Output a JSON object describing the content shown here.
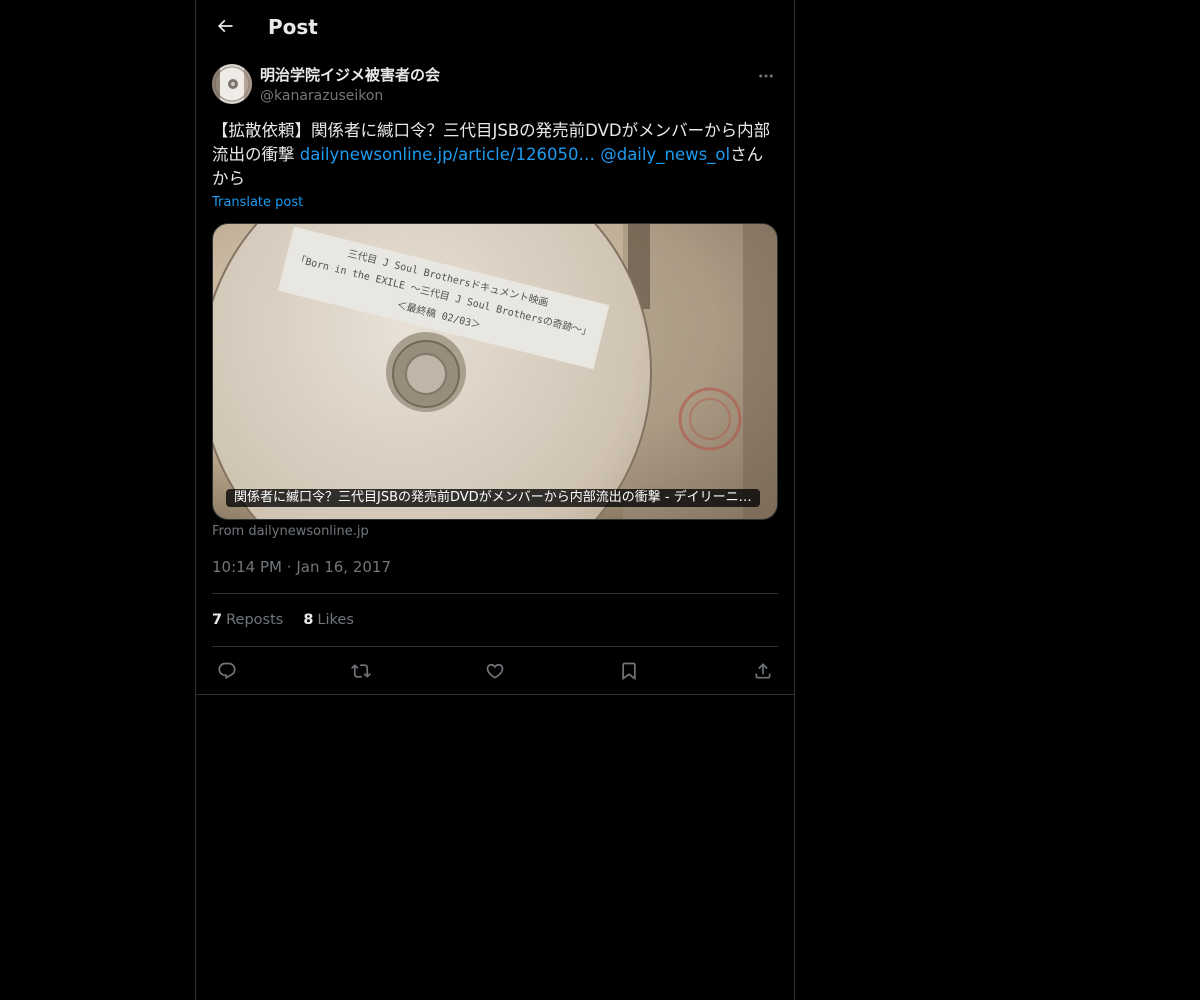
{
  "header": {
    "title": "Post",
    "back_icon": "arrow-left-icon"
  },
  "author": {
    "display_name": "明治学院イジメ被害者の会",
    "handle": "@kanarazuseikon",
    "avatar_icon": "disc-avatar"
  },
  "post": {
    "text_prefix": "【拡散依頼】関係者に緘口令？三代目JSBの発売前DVDがメンバーから内部流出の衝撃 ",
    "link_url": "dailynewsonline.jp/article/126050…",
    "mention": "@daily_news_ol",
    "text_suffix": "さんから",
    "translate_label": "Translate post"
  },
  "card": {
    "caption": "関係者に緘口令？三代目JSBの発売前DVDがメンバーから内部流出の衝撃 - デイリーニ…",
    "source": "From dailynewsonline.jp",
    "disc_label_lines": [
      "三代目 J Soul Brothersドキュメント映画",
      "「Born in the EXILE ～三代目 J Soul Brothersの奇跡～」",
      "＜最終稿 02/03＞"
    ]
  },
  "meta": {
    "time": "10:14 PM",
    "separator": "·",
    "date": "Jan 16, 2017"
  },
  "stats": {
    "reposts_count": "7",
    "reposts_label": "Reposts",
    "likes_count": "8",
    "likes_label": "Likes"
  },
  "actions": [
    "reply-icon",
    "repost-icon",
    "like-icon",
    "bookmark-icon",
    "share-icon"
  ],
  "colors": {
    "background": "#000000",
    "text": "#e7e9ea",
    "muted": "#71767b",
    "accent": "#1d9bf0",
    "border": "#2f3336"
  }
}
